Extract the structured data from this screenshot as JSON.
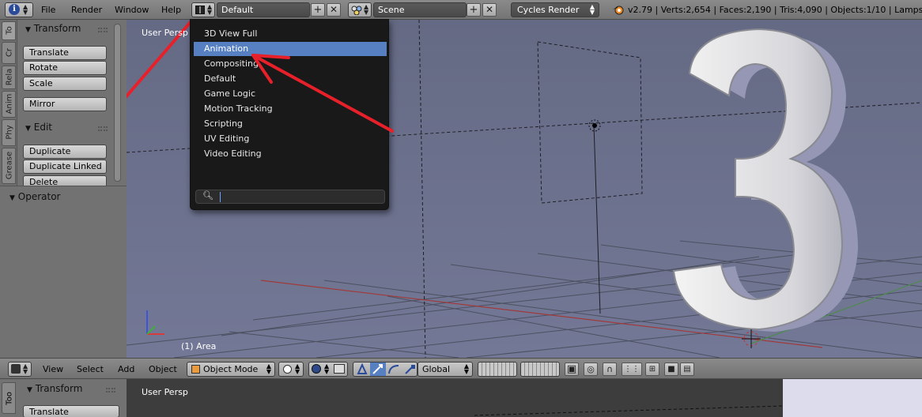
{
  "topbar": {
    "menus": [
      "File",
      "Render",
      "Window",
      "Help"
    ],
    "screen_layout": "Default",
    "scene": "Scene",
    "engine": "Cycles Render",
    "stats": "v2.79 | Verts:2,654 | Faces:2,190 | Tris:4,090 | Objects:1/10 | Lamps:1/6"
  },
  "tabs": [
    "To",
    "Cr",
    "Rela",
    "Anim",
    "Phy",
    "Grease"
  ],
  "tool_panel": {
    "transform_title": "Transform",
    "transform_buttons": [
      "Translate",
      "Rotate",
      "Scale"
    ],
    "mirror": "Mirror",
    "edit_title": "Edit",
    "edit_buttons": [
      "Duplicate",
      "Duplicate Linked",
      "Delete"
    ],
    "operator_title": "Operator"
  },
  "viewport": {
    "label": "User Persp",
    "object_label": "(1) Area",
    "big_glyph": "3"
  },
  "layout_menu": {
    "items": [
      "3D View Full",
      "Animation",
      "Compositing",
      "Default",
      "Game Logic",
      "Motion Tracking",
      "Scripting",
      "UV Editing",
      "Video Editing"
    ],
    "selected": "Animation",
    "search_value": ""
  },
  "header": {
    "menus": [
      "View",
      "Select",
      "Add",
      "Object"
    ],
    "mode": "Object Mode",
    "orientation": "Global"
  },
  "bottom": {
    "tab": "Too",
    "transform_title": "Transform",
    "translate": "Translate",
    "view_label": "User Persp"
  },
  "colors": {
    "selection": "#5680c2",
    "annotation_arrow": "#e8202a",
    "viewport_bg": "#5b607a",
    "menu_bg": "#191919"
  }
}
